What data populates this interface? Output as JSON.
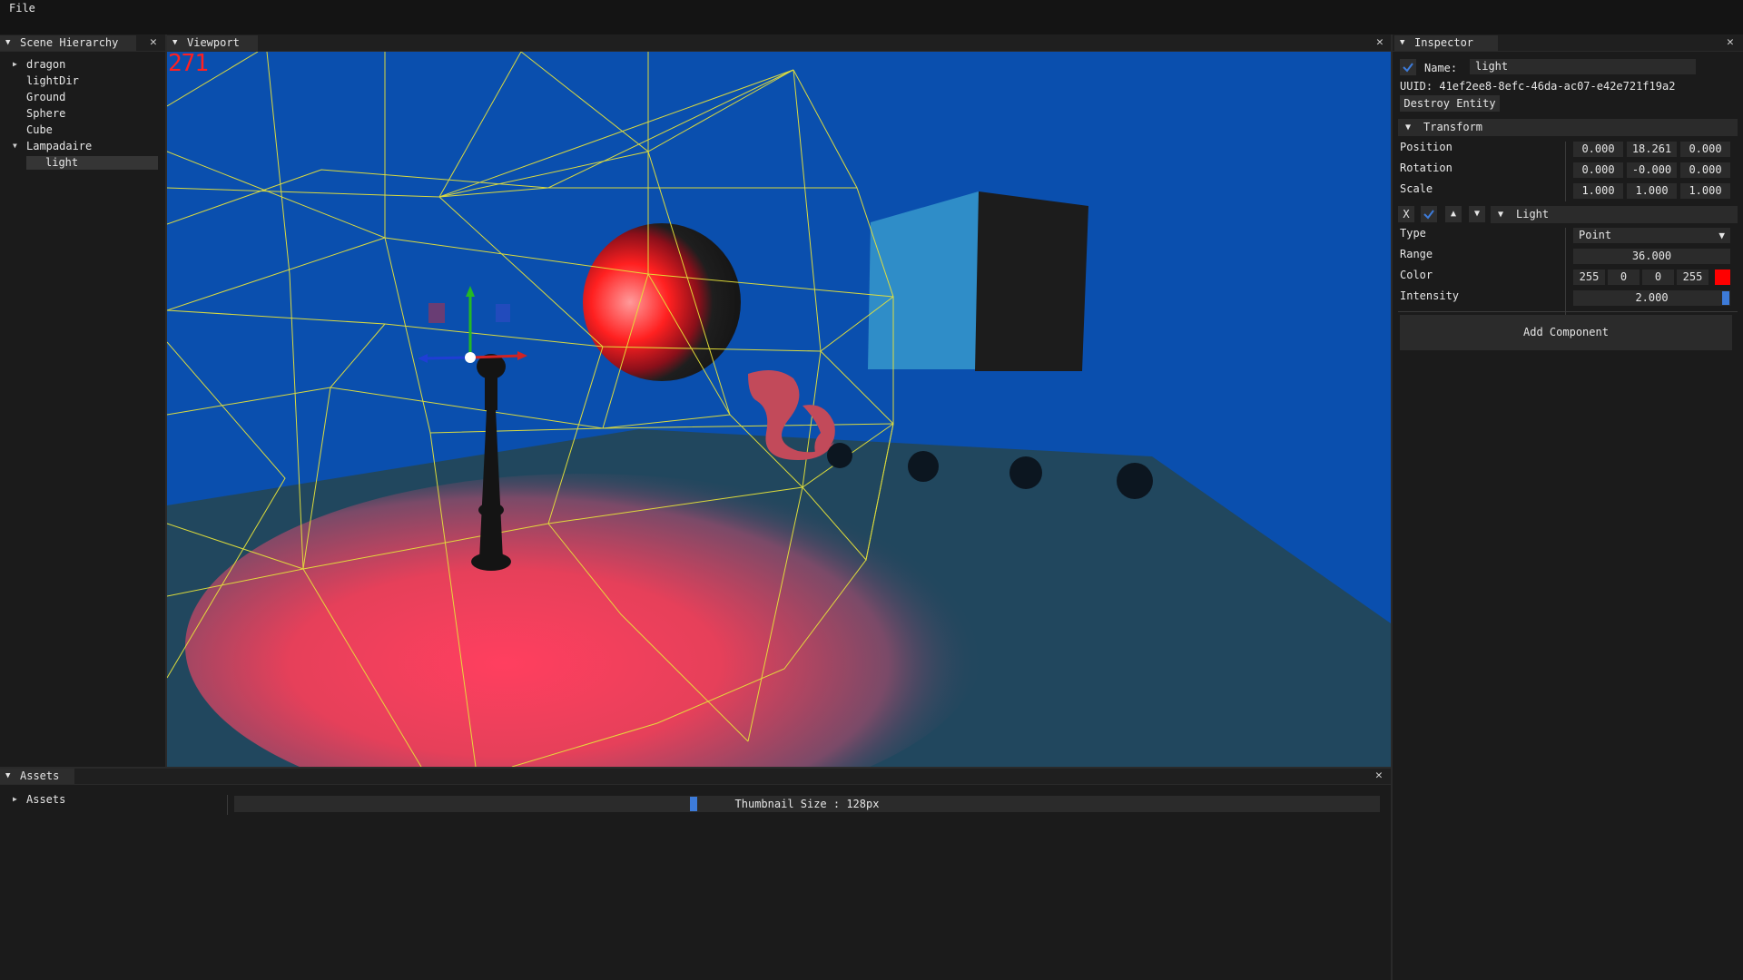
{
  "menu": {
    "file": "File"
  },
  "hierarchy": {
    "tab": "Scene Hierarchy",
    "items": [
      {
        "label": "dragon"
      },
      {
        "label": "lightDir"
      },
      {
        "label": "Ground"
      },
      {
        "label": "Sphere"
      },
      {
        "label": "Cube"
      },
      {
        "label": "Lampadaire"
      },
      {
        "label": "light"
      }
    ]
  },
  "viewport": {
    "tab": "Viewport",
    "fps": "271"
  },
  "inspector": {
    "tab": "Inspector",
    "name_label": "Name:",
    "name_value": "light",
    "uuid": "UUID: 41ef2ee8-8efc-46da-ac07-e42e721f19a2",
    "destroy": "Destroy Entity",
    "transform": {
      "title": "Transform",
      "position_label": "Position",
      "rotation_label": "Rotation",
      "scale_label": "Scale",
      "position": [
        "0.000",
        "18.261",
        "0.000"
      ],
      "rotation": [
        "0.000",
        "-0.000",
        "0.000"
      ],
      "scale": [
        "1.000",
        "1.000",
        "1.000"
      ]
    },
    "light": {
      "title": "Light",
      "remove": "X",
      "type_label": "Type",
      "type_value": "Point",
      "range_label": "Range",
      "range_value": "36.000",
      "color_label": "Color",
      "color_values": [
        "255",
        "0",
        "0",
        "255"
      ],
      "color_swatch": "#ff0000",
      "intensity_label": "Intensity",
      "intensity_value": "2.000"
    },
    "add_component": "Add Component"
  },
  "assets": {
    "tab": "Assets",
    "tree_root": "Assets",
    "thumbnail_label": "Thumbnail Size : 128px",
    "thumbnail_fraction": 0.4
  },
  "colors": {
    "sky": "#0a4fae",
    "ground": "#21475e",
    "accent": "#3d7bd9",
    "wire": "#e6e23a"
  }
}
